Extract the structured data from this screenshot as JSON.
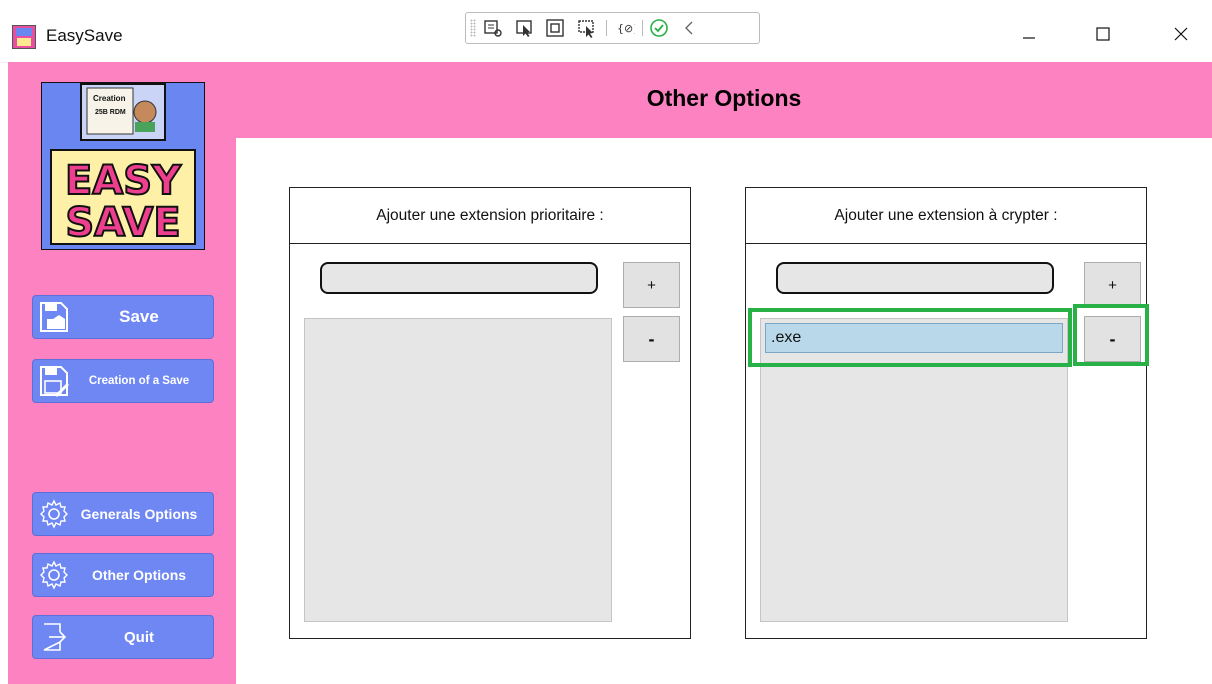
{
  "window": {
    "title": "EasySave",
    "controls": {
      "minimize": "—",
      "maximize": "☐",
      "close": "✕"
    }
  },
  "sidebar": {
    "logo": {
      "text_line1": "EASY",
      "text_line2": "SAVE",
      "label_line1": "Creation",
      "label_line2": "25B RDM"
    },
    "nav": [
      {
        "label": "Save",
        "icon": "floppy-disk-icon"
      },
      {
        "label": "Creation of a Save",
        "icon": "floppy-disk-edit-icon"
      },
      {
        "label": "Generals Options",
        "icon": "gear-icon"
      },
      {
        "label": "Other Options",
        "icon": "gear-icon"
      },
      {
        "label": "Quit",
        "icon": "exit-icon"
      }
    ]
  },
  "header": {
    "title": "Other Options"
  },
  "panels": {
    "priority": {
      "title": "Ajouter une extension prioritaire :",
      "input_value": "",
      "add_label": "+",
      "remove_label": "-",
      "items": []
    },
    "crypt": {
      "title": "Ajouter une extension à crypter :",
      "input_value": "",
      "add_label": "+",
      "remove_label": "-",
      "items": [
        ".exe"
      ]
    }
  },
  "colors": {
    "pink": "#fd82c2",
    "nav_blue": "#6f87f3",
    "highlight_green": "#27b146",
    "selection_blue": "#b9d8ea"
  }
}
